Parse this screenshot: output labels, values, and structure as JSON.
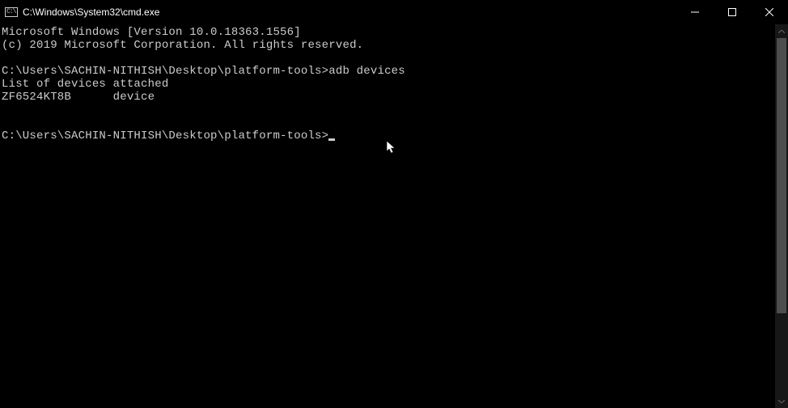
{
  "window": {
    "title": "C:\\Windows\\System32\\cmd.exe"
  },
  "terminal": {
    "line1": "Microsoft Windows [Version 10.0.18363.1556]",
    "line2": "(c) 2019 Microsoft Corporation. All rights reserved.",
    "blank1": "",
    "prompt1_path": "C:\\Users\\SACHIN-NITHISH\\Desktop\\platform-tools>",
    "prompt1_cmd": "adb devices",
    "output1": "List of devices attached",
    "output2": "ZF6524KT8B      device",
    "blank2": "",
    "blank3": "",
    "prompt2_path": "C:\\Users\\SACHIN-NITHISH\\Desktop\\platform-tools>"
  }
}
